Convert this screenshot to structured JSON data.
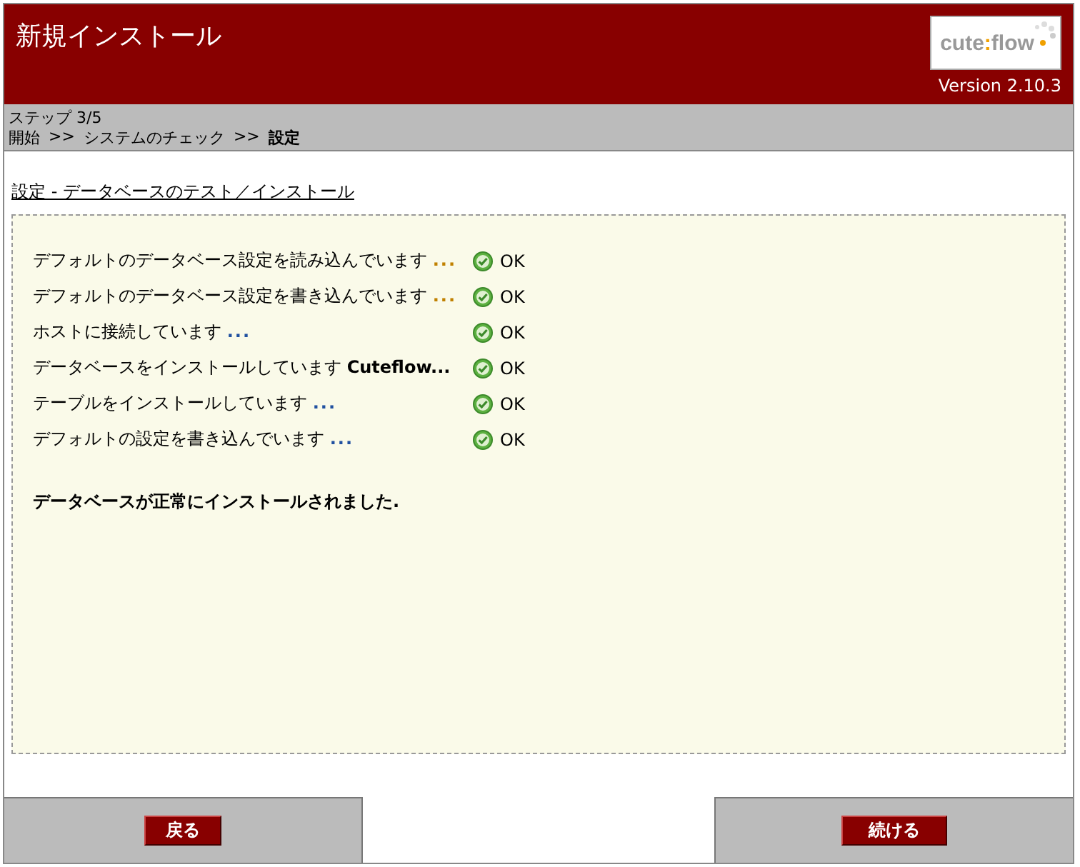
{
  "header": {
    "title": "新規インストール",
    "logo": {
      "left": "cute",
      "separator": ":",
      "right": "flow"
    },
    "version": "Version 2.10.3"
  },
  "step": "ステップ 3/5",
  "breadcrumb": [
    {
      "label": "開始",
      "selected": false
    },
    {
      "label": "システムのチェック",
      "selected": false
    },
    {
      "label": "設定",
      "selected": true
    }
  ],
  "breadcrumb_separator": ">>",
  "section_title": "設定 - データベースのテスト／インストール",
  "tasks": [
    {
      "text": "デフォルトのデータベース設定を読み込んでいます",
      "kind": "dots",
      "suffix": "...",
      "color": "#c08000",
      "status": "OK"
    },
    {
      "text": "デフォルトのデータベース設定を書き込んでいます",
      "kind": "dots",
      "suffix": "...",
      "color": "#c08000",
      "status": "OK"
    },
    {
      "text": "ホストに接続しています",
      "kind": "dots",
      "suffix": "...",
      "color": "#2050a0",
      "status": "OK"
    },
    {
      "text": "データベースをインストールしています",
      "kind": "name",
      "suffix": "Cuteflow...",
      "color": "#000000",
      "status": "OK"
    },
    {
      "text": "テーブルをインストールしています",
      "kind": "dots",
      "suffix": "...",
      "color": "#2050a0",
      "status": "OK"
    },
    {
      "text": "デフォルトの設定を書き込んでいます",
      "kind": "dots",
      "suffix": "...",
      "color": "#2050a0",
      "status": "OK"
    }
  ],
  "result": "データベースが正常にインストールされました.",
  "buttons": {
    "back": "戻る",
    "next": "続ける"
  }
}
